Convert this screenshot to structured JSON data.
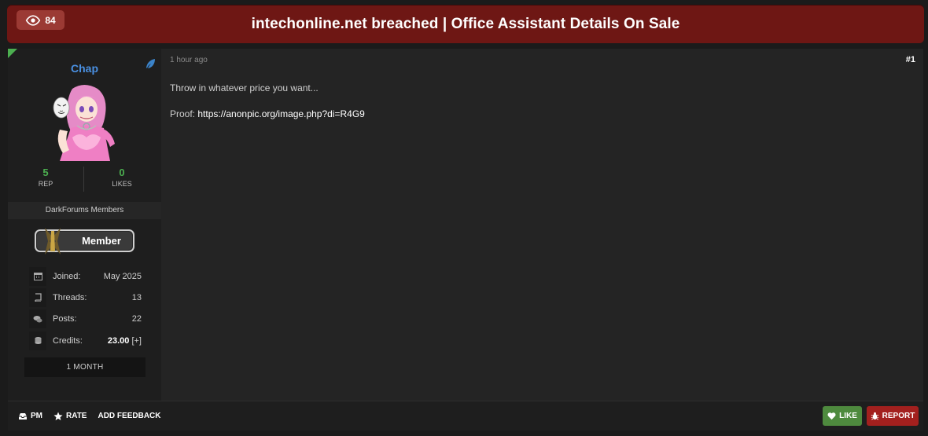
{
  "header": {
    "views": "84",
    "title": "intechonline.net breached | Office Assistant Details On Sale"
  },
  "user": {
    "name": "Chap",
    "rep_value": "5",
    "rep_label": "REP",
    "likes_value": "0",
    "likes_label": "LIKES",
    "group": "DarkForums Members",
    "badge": "Member",
    "info": [
      {
        "icon": "calendar-icon",
        "label": "Joined:",
        "value": "May 2025"
      },
      {
        "icon": "book-icon",
        "label": "Threads:",
        "value": "13"
      },
      {
        "icon": "comments-icon",
        "label": "Posts:",
        "value": "22"
      },
      {
        "icon": "coins-icon",
        "label": "Credits:",
        "value": "23.00",
        "extra": "[+]"
      }
    ],
    "duration": "1 MONTH"
  },
  "post": {
    "time": "1 hour ago",
    "number": "#1",
    "line1": "Throw in whatever price you want...",
    "proof_label": "Proof:",
    "proof_link": "https://anonpic.org/image.php?di=R4G9"
  },
  "footer": {
    "pm": "PM",
    "rate": "RATE",
    "feedback": "ADD FEEDBACK",
    "like": "LIKE",
    "report": "REPORT"
  },
  "colors": {
    "header_bg": "#6e1714",
    "username": "#4a90e2",
    "stat_green": "#4caf50",
    "like_btn": "#4e8a3e",
    "report_btn": "#a3201e"
  }
}
